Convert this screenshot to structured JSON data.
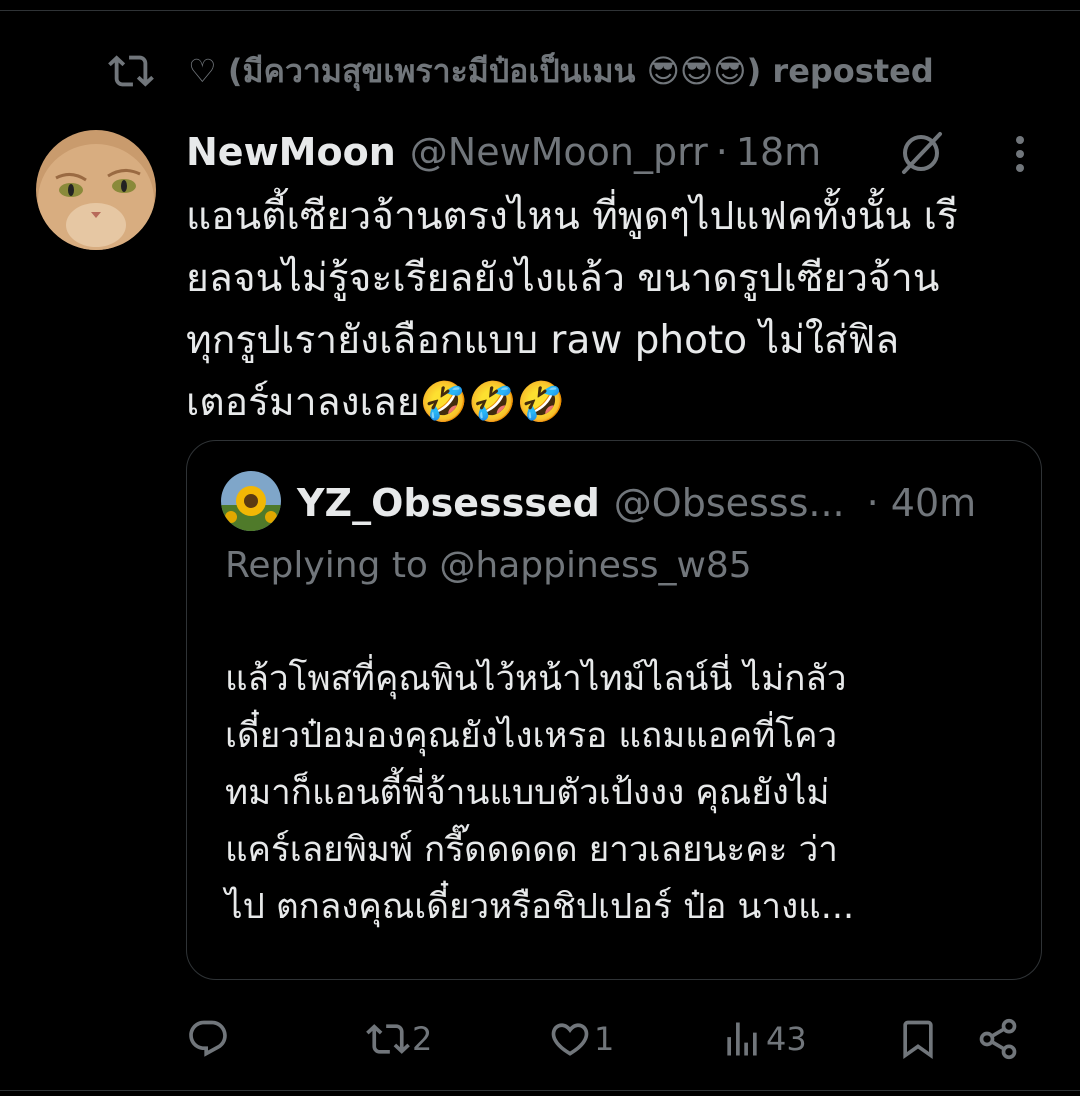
{
  "repost": {
    "label": "♡ (มีความสุขเพราะมีป๋อเป็นเมน 😎😎😎) reposted"
  },
  "post": {
    "display_name": "NewMoon",
    "handle": "@NewMoon_prr",
    "separator": "·",
    "time": "18m",
    "text_lines": [
      "แอนตี้เซียวจ้านตรงไหน ที่พูดๆไปแฟคทั้งนั้น เรี",
      "ยลจนไม่รู้จะเรียลยังไงแล้ว ขนาดรูปเซียวจ้าน",
      "ทุกรูปเรายังเลือกแบบ raw photo ไม่ใส่ฟิล",
      "เตอร์มาลงเลย🤣🤣🤣"
    ]
  },
  "quote": {
    "display_name": "YZ_Obsesssed",
    "handle": "@Obsesss...",
    "time": "· 40m",
    "replying_to": "Replying to @happiness_w85",
    "text_lines": [
      "แล้วโพสที่คุณพินไว้หน้าไทม์ไลน์นี่ ไม่กลัว",
      "เดี๋ยวป๋อมองคุณยังไงเหรอ แถมแอคที่โคว",
      "ทมาก็แอนตี้พี่จ้านแบบตัวเป้งงง คุณยังไม่",
      "แคร์เลยพิมพ์ กรี๊ดดดดด ยาวเลยนะคะ ว่า",
      "ไป ตกลงคุณเดี๋ยวหรือชิปเปอร์ ป๋อ นางแ..."
    ]
  },
  "actions": {
    "replies": "",
    "reposts": "2",
    "likes": "1",
    "views": "43"
  },
  "icons": [
    "repost-icon",
    "grok-icon",
    "more-icon",
    "reply-icon",
    "like-icon",
    "views-icon",
    "bookmark-icon",
    "share-icon"
  ],
  "colors": {
    "background": "#000000",
    "text": "#e7e9ea",
    "secondary": "#71767b",
    "border": "#2f3336"
  }
}
